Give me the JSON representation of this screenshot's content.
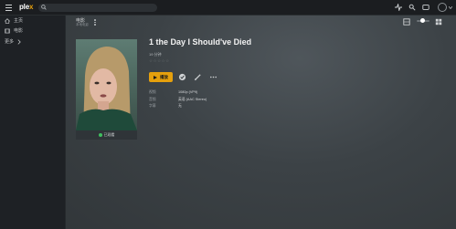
{
  "topbar": {
    "logo_main": "ple",
    "logo_accent": "x",
    "search_placeholder": ""
  },
  "sidebar": {
    "items": [
      {
        "label": "主页",
        "icon": "home-icon"
      },
      {
        "label": "电影",
        "icon": "film-icon"
      },
      {
        "label": "更多",
        "icon": "chevron-right-icon"
      }
    ]
  },
  "header": {
    "library": "电影",
    "library_sub": "本地电影"
  },
  "movie": {
    "title": "1 the Day I Should've Died",
    "duration": "19 分钟",
    "rating_stars": "☆☆☆☆☆",
    "play_label": "播放",
    "status": "已观看",
    "meta": [
      {
        "key": "视频",
        "value": "1080p (VP9)"
      },
      {
        "key": "音频",
        "value": "英语 (AAC Stereo)"
      },
      {
        "key": "字幕",
        "value": "无"
      }
    ]
  },
  "colors": {
    "accent": "#e5a00d",
    "background": "#1f2326",
    "watched_dot": "#3fbf5f"
  }
}
